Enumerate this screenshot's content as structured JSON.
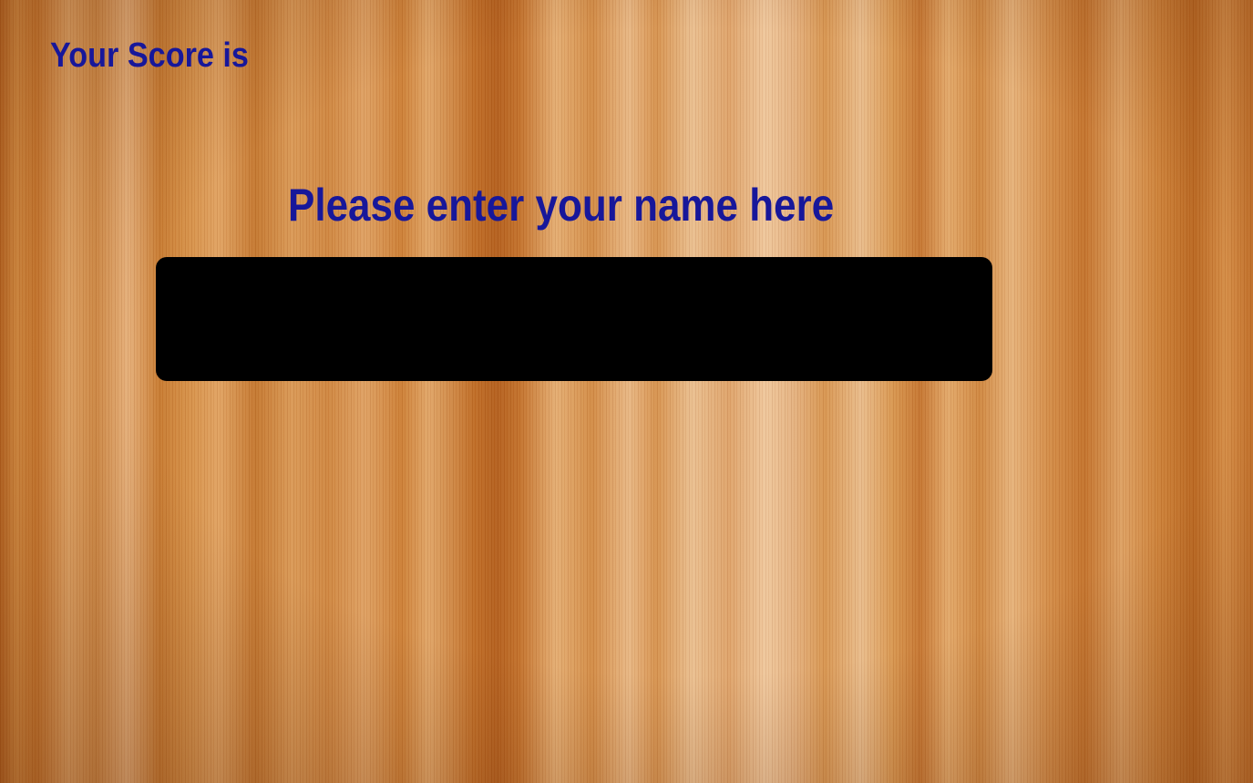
{
  "score": {
    "label": "Your Score is"
  },
  "prompt": {
    "text": "Please enter your name here"
  },
  "name_input": {
    "value": "",
    "placeholder": ""
  },
  "colors": {
    "text_accent": "#17179a",
    "input_background": "#000000",
    "wood_light": "#e8b784",
    "wood_dark": "#b35e1c"
  }
}
